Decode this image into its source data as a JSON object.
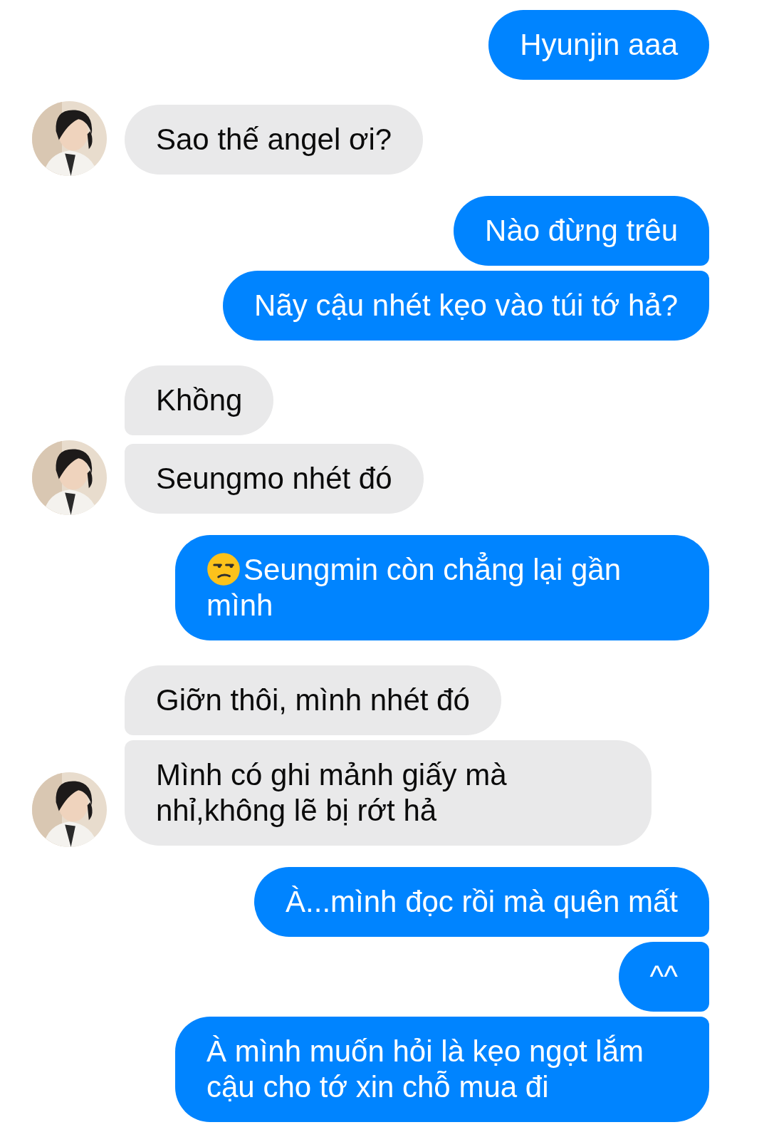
{
  "messages": [
    {
      "kind": "me",
      "text": "Hyunjin aaa"
    },
    {
      "kind": "them",
      "text": "Sao thế angel ơi?",
      "avatar": true
    },
    {
      "kind": "me",
      "text": "Nào đừng trêu"
    },
    {
      "kind": "me",
      "text": "Nãy cậu nhét kẹo vào túi tớ hả?"
    },
    {
      "kind": "them",
      "text": "Khồng",
      "avatar": false
    },
    {
      "kind": "them",
      "text": "Seungmo nhét đó",
      "avatar": true
    },
    {
      "kind": "me",
      "text": "Seungmin còn chẳng lại gần mình",
      "leading_emoji": true
    },
    {
      "kind": "them",
      "text": "Giỡn thôi, mình nhét đó",
      "avatar": false
    },
    {
      "kind": "them",
      "text": "Mình có ghi mảnh giấy mà nhỉ,không lẽ bị rớt hả",
      "avatar": true
    },
    {
      "kind": "me",
      "text": "À...mình đọc rồi mà quên mất"
    },
    {
      "kind": "me",
      "text": "^^"
    },
    {
      "kind": "me",
      "text": "À mình muốn hỏi là kẹo ngọt lắm cậu cho tớ xin chỗ mua đi"
    }
  ]
}
